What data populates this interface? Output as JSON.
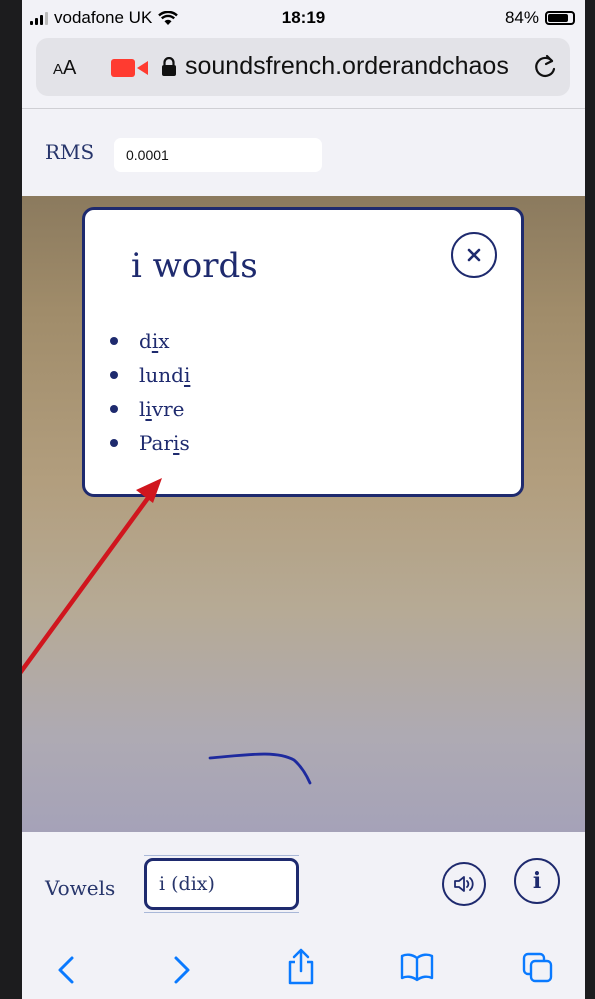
{
  "status_bar": {
    "carrier": "vodafone UK",
    "time": "18:19",
    "battery": "84%",
    "battery_level": 0.84
  },
  "browser": {
    "text_size_label": "AA",
    "url": "soundsfrench.orderandchaos"
  },
  "rms": {
    "label": "RMS",
    "value": "0.0001"
  },
  "popup": {
    "title": "i words",
    "words": [
      {
        "pre": "d",
        "hl": "i",
        "post": "x"
      },
      {
        "pre": "lund",
        "hl": "i",
        "post": ""
      },
      {
        "pre": "l",
        "hl": "i",
        "post": "vre"
      },
      {
        "pre": "Par",
        "hl": "i",
        "post": "s"
      }
    ]
  },
  "controls": {
    "vowels_label": "Vowels",
    "selected_vowel": "i (dix)",
    "info_label": "i"
  },
  "colors": {
    "accent": "#1e2a6e",
    "arrow": "#d0161e",
    "system_blue": "#0a7aff",
    "record_red": "#ff3b30"
  },
  "icons": [
    "wifi-icon",
    "video-camera-icon",
    "lock-icon",
    "reload-icon",
    "close-icon",
    "speaker-icon",
    "info-icon",
    "back-icon",
    "forward-icon",
    "share-icon",
    "bookmarks-icon",
    "tabs-icon"
  ]
}
